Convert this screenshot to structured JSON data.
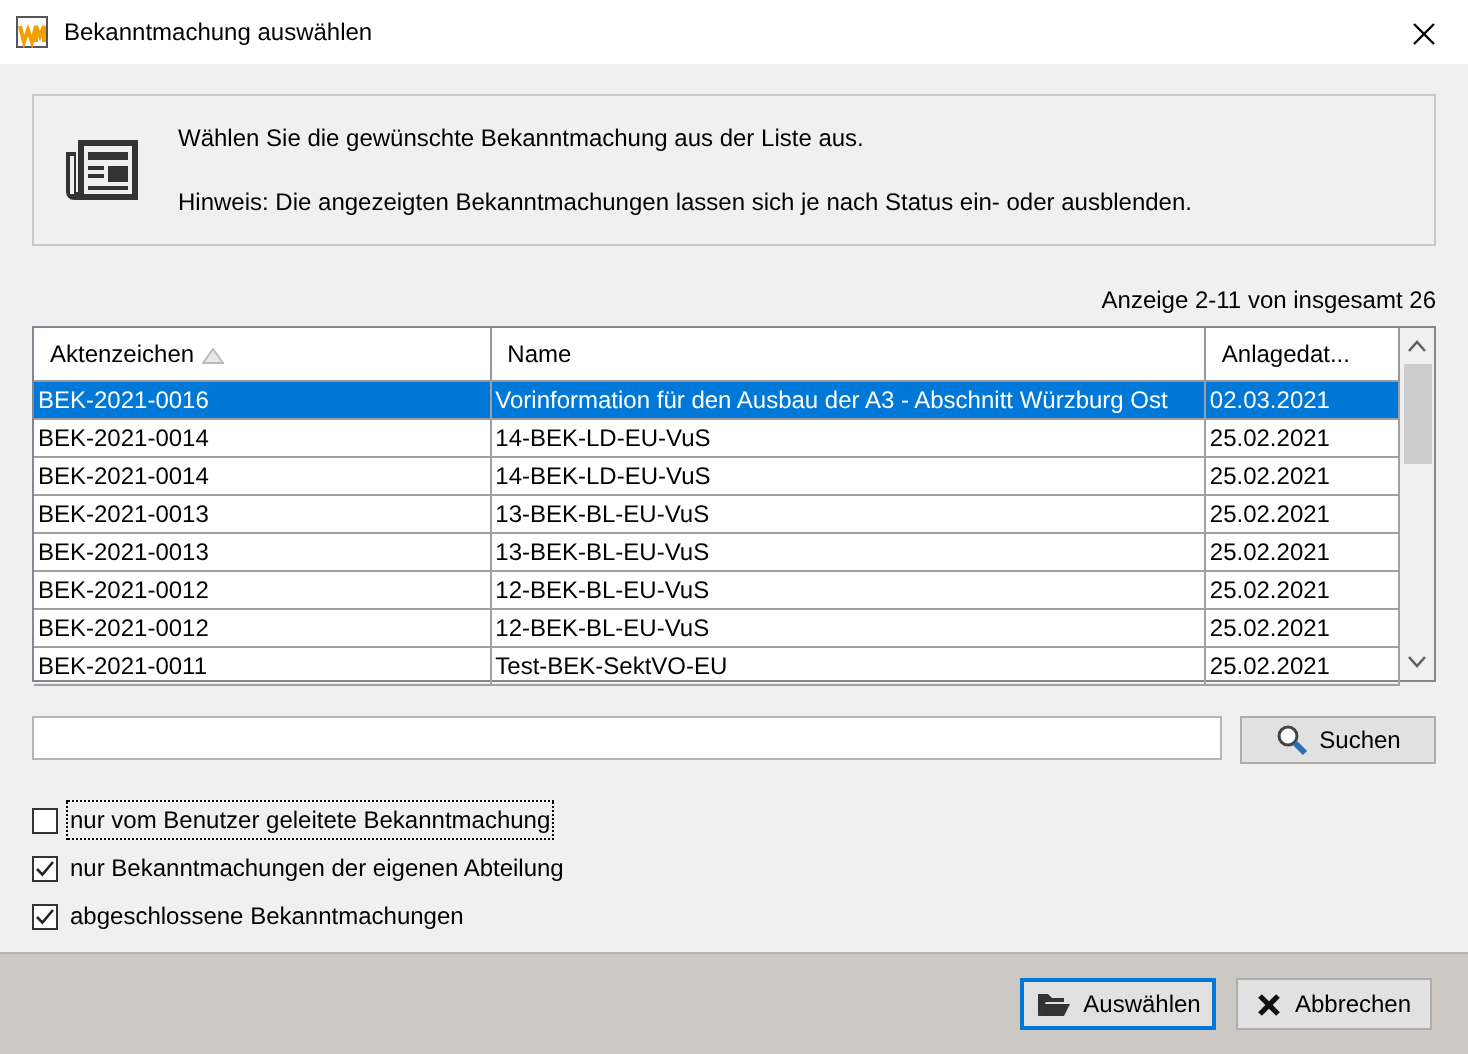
{
  "window": {
    "title": "Bekanntmachung auswählen"
  },
  "info": {
    "lines": [
      "Wählen Sie die gewünschte Bekanntmachung aus der Liste aus.",
      "Hinweis: Die angezeigten Bekanntmachungen lassen sich je nach Status ein- oder ausblenden."
    ]
  },
  "count": "Anzeige 2-11 von insgesamt 26",
  "table": {
    "columns": [
      {
        "label": "Aktenzeichen",
        "sorted": true
      },
      {
        "label": "Name",
        "sorted": false
      },
      {
        "label": "Anlagedat...",
        "sorted": false
      }
    ],
    "rows": [
      {
        "cells": [
          "BEK-2021-0016",
          "Vorinformation für den Ausbau der A3 - Abschnitt Würzburg Ost",
          "02.03.2021"
        ],
        "selected": true
      },
      {
        "cells": [
          "BEK-2021-0014",
          "14-BEK-LD-EU-VuS",
          "25.02.2021"
        ],
        "selected": false
      },
      {
        "cells": [
          "BEK-2021-0014",
          "14-BEK-LD-EU-VuS",
          "25.02.2021"
        ],
        "selected": false
      },
      {
        "cells": [
          "BEK-2021-0013",
          "13-BEK-BL-EU-VuS",
          "25.02.2021"
        ],
        "selected": false
      },
      {
        "cells": [
          "BEK-2021-0013",
          "13-BEK-BL-EU-VuS",
          "25.02.2021"
        ],
        "selected": false
      },
      {
        "cells": [
          "BEK-2021-0012",
          "12-BEK-BL-EU-VuS",
          "25.02.2021"
        ],
        "selected": false
      },
      {
        "cells": [
          "BEK-2021-0012",
          "12-BEK-BL-EU-VuS",
          "25.02.2021"
        ],
        "selected": false
      },
      {
        "cells": [
          "BEK-2021-0011",
          "Test-BEK-SektVO-EU",
          "25.02.2021"
        ],
        "selected": false
      }
    ]
  },
  "search": {
    "button": "Suchen"
  },
  "filters": [
    {
      "label": "nur vom Benutzer geleitete Bekanntmachung",
      "checked": false,
      "focused": true
    },
    {
      "label": "nur Bekanntmachungen der eigenen Abteilung",
      "checked": true,
      "focused": false
    },
    {
      "label": "abgeschlossene Bekanntmachungen",
      "checked": true,
      "focused": false
    }
  ],
  "buttons": [
    {
      "label": "Auswählen",
      "kind": "select",
      "default": true
    },
    {
      "label": "Abbrechen",
      "kind": "cancel",
      "default": false
    }
  ]
}
